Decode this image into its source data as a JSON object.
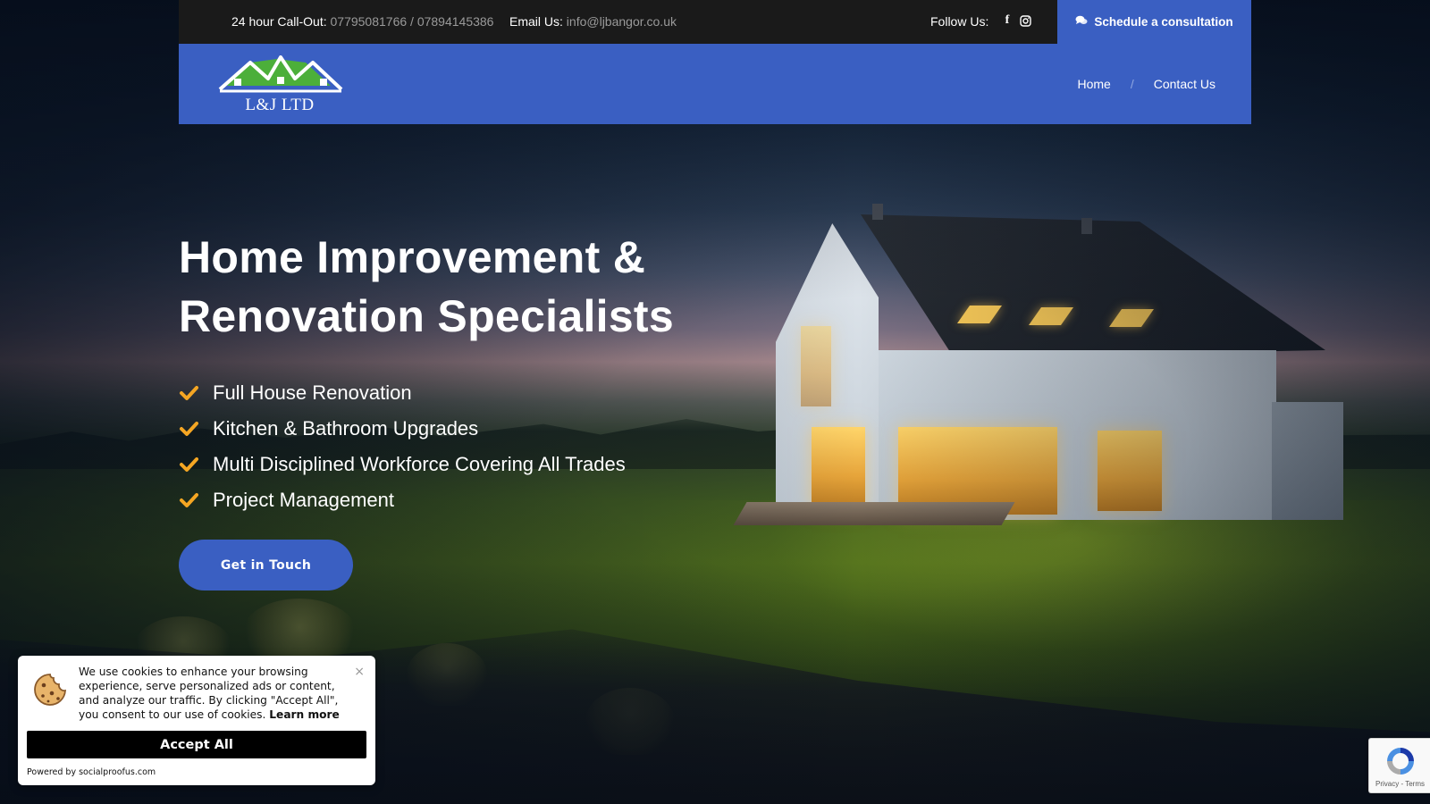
{
  "topbar": {
    "callout_label": "24 hour Call-Out:",
    "callout_numbers": "07795081766 / 07894145386",
    "email_label": "Email Us:",
    "email_value": "info@ljbangor.co.uk",
    "follow_label": "Follow Us:",
    "social_icons": [
      "facebook-icon",
      "instagram-icon"
    ],
    "schedule_button": "Schedule a consultation"
  },
  "navbar": {
    "logo_text": "L&J LTD",
    "links": [
      "Home",
      "Contact Us"
    ],
    "separator": "/"
  },
  "hero": {
    "title_line1": "Home Improvement &",
    "title_line2": "Renovation Specialists",
    "features": [
      "Full House Renovation",
      "Kitchen & Bathroom Upgrades",
      "Multi Disciplined Workforce Covering All Trades",
      "Project Management"
    ],
    "cta_label": "Get in Touch"
  },
  "cookie_banner": {
    "message": "We use cookies to enhance your browsing experience, serve personalized ads or content, and analyze our traffic. By clicking \"Accept All\", you consent to our use of cookies.",
    "learn_more": "Learn more",
    "close_symbol": "×",
    "accept_label": "Accept All",
    "powered_by": "Powered by socialproofus.com"
  },
  "recaptcha": {
    "privacy": "Privacy",
    "separator": " - ",
    "terms": "Terms"
  },
  "colors": {
    "brand_blue": "#3a5fc2",
    "topbar_bg": "#1a1a1a",
    "check_orange": "#f5a623",
    "logo_roof_green": "#4caf3a"
  }
}
